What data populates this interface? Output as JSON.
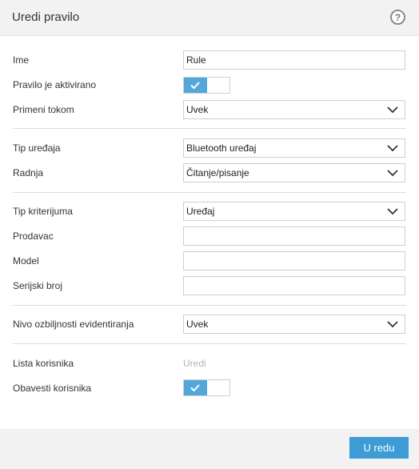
{
  "dialog": {
    "title": "Uredi pravilo",
    "help_symbol": "?"
  },
  "fields": {
    "name": {
      "label": "Ime",
      "value": "Rule"
    },
    "enabled": {
      "label": "Pravilo je aktivirano",
      "state": "on"
    },
    "apply_during": {
      "label": "Primeni tokom",
      "value": "Uvek"
    },
    "device_type": {
      "label": "Tip uređaja",
      "value": "Bluetooth uređaj"
    },
    "action": {
      "label": "Radnja",
      "value": "Čitanje/pisanje"
    },
    "criteria_type": {
      "label": "Tip kriterijuma",
      "value": "Uređaj"
    },
    "vendor": {
      "label": "Prodavac",
      "value": ""
    },
    "model": {
      "label": "Model",
      "value": ""
    },
    "serial": {
      "label": "Serijski broj",
      "value": ""
    },
    "log_severity": {
      "label": "Nivo ozbiljnosti evidentiranja",
      "value": "Uvek"
    },
    "user_list": {
      "label": "Lista korisnika",
      "edit_link": "Uredi"
    },
    "notify_user": {
      "label": "Obavesti korisnika",
      "state": "on"
    }
  },
  "footer": {
    "ok_label": "U redu"
  },
  "colors": {
    "accent": "#3d9bd6",
    "toggle_on": "#54a7d9"
  },
  "icons": {
    "help": "question-circle-icon",
    "dropdown": "chevron-down-icon",
    "check": "checkmark-icon"
  }
}
